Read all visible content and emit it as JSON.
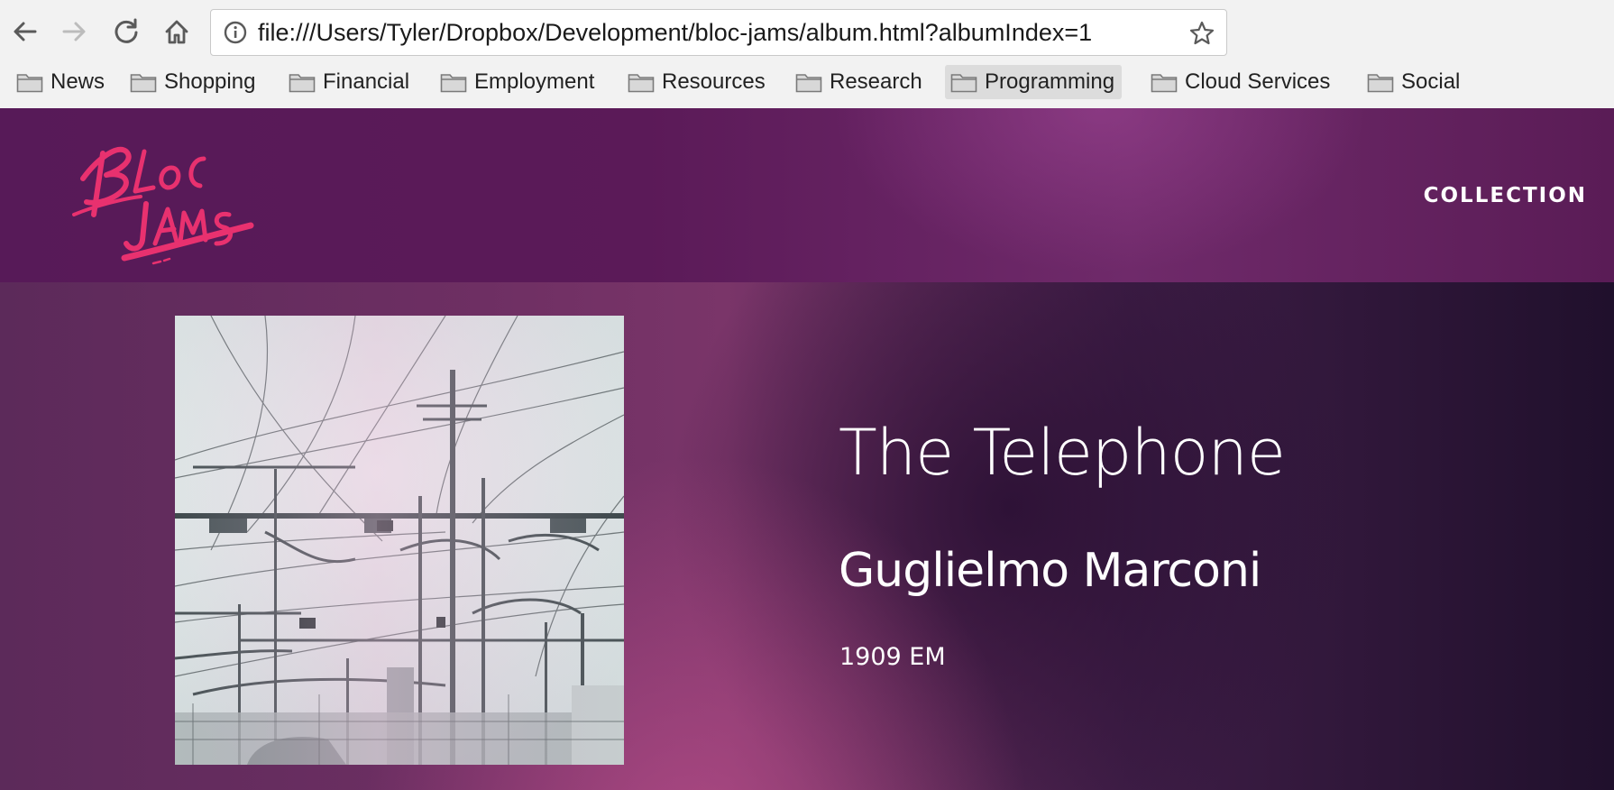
{
  "browser": {
    "url": "file:///Users/Tyler/Dropbox/Development/bloc-jams/album.html?albumIndex=1",
    "bookmarks": [
      {
        "label": "News",
        "icon": "folder-icon"
      },
      {
        "label": "Shopping",
        "icon": "folder-icon"
      },
      {
        "label": "Financial",
        "icon": "folder-icon"
      },
      {
        "label": "Employment",
        "icon": "folder-icon"
      },
      {
        "label": "Resources",
        "icon": "folder-icon"
      },
      {
        "label": "Research",
        "icon": "folder-icon"
      },
      {
        "label": "Programming",
        "icon": "folder-icon",
        "active": true
      },
      {
        "label": "Cloud Services",
        "icon": "folder-icon"
      },
      {
        "label": "Social",
        "icon": "folder-icon"
      }
    ],
    "icons": {
      "back": "back-arrow-icon",
      "forward": "forward-arrow-icon",
      "reload": "reload-icon",
      "home": "home-icon",
      "info": "info-icon",
      "bookmark": "star-icon"
    }
  },
  "site": {
    "logo_alt": "Bloc Jams",
    "nav": {
      "collection": "COLLECTION"
    },
    "colors": {
      "header": "#5b1a58",
      "logo": "#e8316f",
      "text": "#ffffff"
    }
  },
  "album": {
    "title": "The Telephone",
    "artist": "Guglielmo Marconi",
    "release_info": "1909 EM",
    "cover_alt": "album-cover-power-lines"
  }
}
